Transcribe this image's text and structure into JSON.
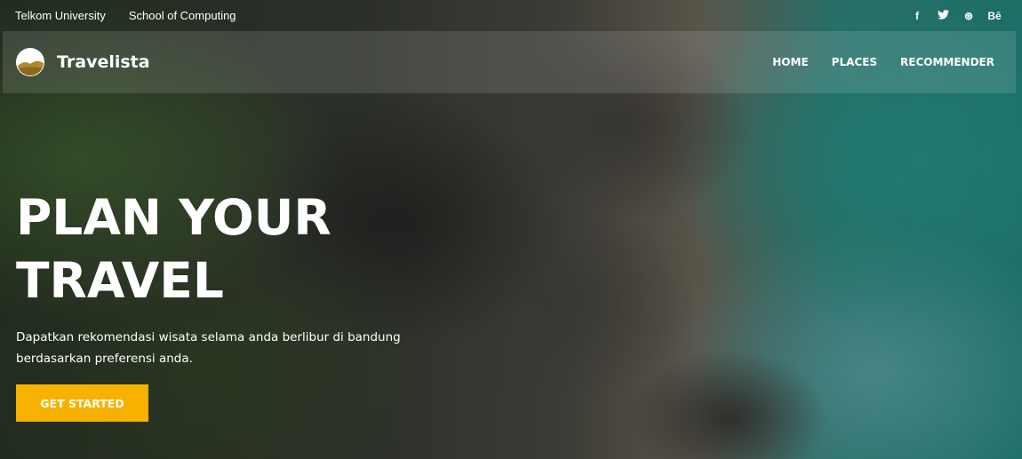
{
  "topbar": {
    "links": [
      "Telkom University",
      "School of Computing"
    ],
    "social": [
      {
        "icon": "facebook-icon",
        "glyph": "f"
      },
      {
        "icon": "twitter-icon",
        "glyph": "🐦"
      },
      {
        "icon": "dribbble-icon",
        "glyph": "⊛"
      },
      {
        "icon": "behance-icon",
        "glyph": "Bē"
      }
    ]
  },
  "navbar": {
    "brand": "Travelista",
    "menu": [
      "HOME",
      "PLACES",
      "RECOMMENDER"
    ]
  },
  "hero": {
    "title": "PLAN YOUR TRAVEL",
    "subtitle": "Dapatkan rekomendasi wisata selama anda berlibur di bandung berdasarkan preferensi anda.",
    "cta": "GET STARTED"
  },
  "colors": {
    "accent": "#f7b100"
  }
}
